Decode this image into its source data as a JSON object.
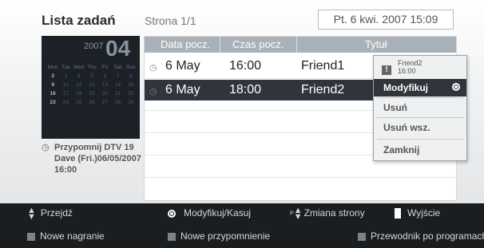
{
  "header": {
    "title": "Lista zadań",
    "page_indicator": "Strona 1/1",
    "datetime": "Pt. 6 kwi. 2007 15:09"
  },
  "calendar": {
    "year": "2007",
    "month": "04",
    "weekdays": [
      "Mon",
      "Tue",
      "Wed",
      "Thu",
      "Fri",
      "Sat",
      "Sun"
    ],
    "weeks": [
      [
        "2",
        "3",
        "4",
        "5",
        "6",
        "7",
        "8"
      ],
      [
        "9",
        "10",
        "11",
        "12",
        "13",
        "14",
        "15"
      ],
      [
        "16",
        "17",
        "18",
        "19",
        "20",
        "21",
        "22"
      ],
      [
        "23",
        "24",
        "25",
        "26",
        "27",
        "28",
        "29"
      ]
    ]
  },
  "reminder": {
    "text": "Przypomnij DTV 19 Dave (Fri.)06/05/2007 16:00"
  },
  "table": {
    "columns": [
      "Data pocz.",
      "Czas pocz.",
      "Tytuł"
    ],
    "rows": [
      {
        "date": "6 May",
        "time": "16:00",
        "title": "Friend1"
      },
      {
        "date": "6 May",
        "time": "18:00",
        "title": "Friend2"
      }
    ]
  },
  "popup": {
    "header_title": "Friend2",
    "header_time": "16:00",
    "items": [
      "Modyfikuj",
      "Usuń",
      "Usuń wsz.",
      "Zamknij"
    ]
  },
  "footer": {
    "move": "Przejdź",
    "modify_delete": "Modyfikuj/Kasuj",
    "page_change_prefix": "P",
    "page_change": "Zmiana strony",
    "exit": "Wyjście",
    "new_recording": "Nowe nagranie",
    "new_reminder": "Nowe przypomnienie",
    "program_guide": "Przewodnik po programach"
  },
  "colors": {
    "header_row": "#a9b1b8",
    "selected_row": "#2f353b",
    "footer_bg": "#1b1e21"
  }
}
